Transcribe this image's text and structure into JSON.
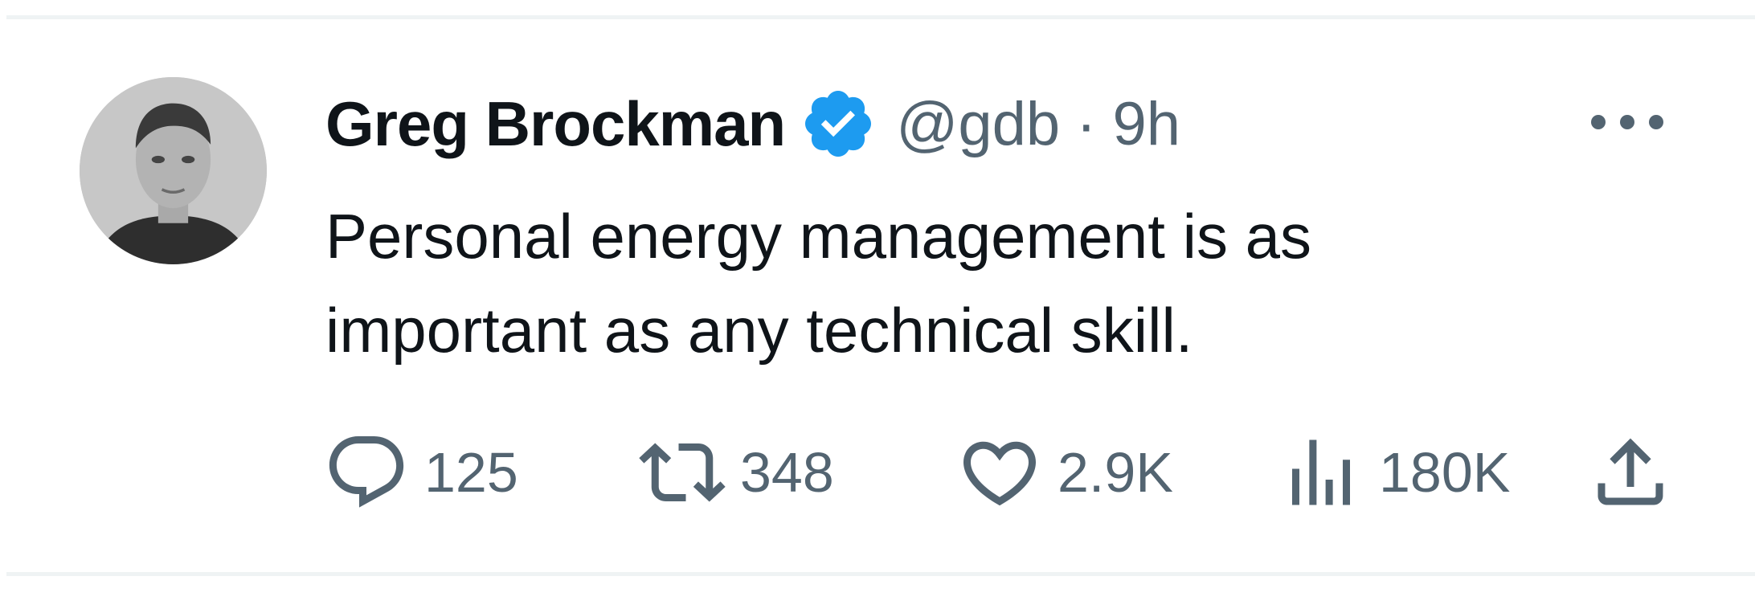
{
  "tweet": {
    "author_name": "Greg Brockman",
    "handle": "@gdb",
    "separator": "·",
    "time": "9h",
    "text": "Personal energy management is as important as any technical skill."
  },
  "metrics": {
    "replies": "125",
    "retweets": "348",
    "likes": "2.9K",
    "views": "180K"
  },
  "icons": {
    "verified": "verified-badge-icon",
    "more": "more-horizontal-icon",
    "reply": "reply-bubble-icon",
    "retweet": "retweet-icon",
    "like": "heart-icon",
    "views": "bar-chart-icon",
    "share": "share-upload-icon"
  },
  "colors": {
    "text_primary": "#0f1419",
    "text_secondary": "#536471",
    "verified_blue": "#1d9bf0",
    "divider": "#eff3f4"
  }
}
